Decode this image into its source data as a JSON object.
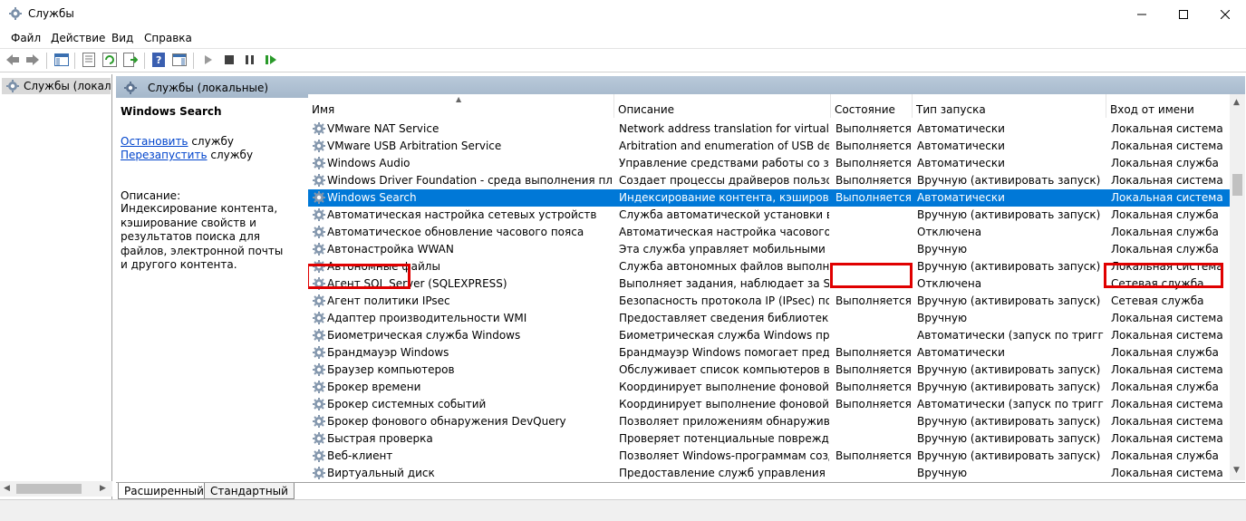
{
  "window": {
    "title": "Службы",
    "controls": {
      "minimize": "minimize-icon",
      "maximize": "maximize-icon",
      "close": "close-icon"
    }
  },
  "menu": {
    "file": "Файл",
    "action": "Действие",
    "view": "Вид",
    "help": "Справка"
  },
  "toolbar": {
    "icons": [
      "back-icon",
      "forward-icon",
      "show-console-tree-icon",
      "properties-icon",
      "refresh-icon",
      "export-list-icon",
      "help-icon",
      "show-hide-action-pane-icon",
      "start-service-icon",
      "stop-service-icon",
      "pause-service-icon",
      "restart-service-icon"
    ]
  },
  "tree": {
    "root_label": "Службы (локалы"
  },
  "pane": {
    "header": "Службы (локальные)"
  },
  "details": {
    "service_name": "Windows Search",
    "stop_link": "Остановить",
    "stop_suffix": " службу",
    "restart_link": "Перезапустить",
    "restart_suffix": " службу",
    "description_label": "Описание:",
    "description": "Индексирование контента, кэширование свойств и результатов поиска для файлов, электронной почты и другого контента."
  },
  "columns": {
    "name": "Имя",
    "description": "Описание",
    "status": "Состояние",
    "startup": "Тип запуска",
    "logon": "Вход от имени"
  },
  "services": [
    {
      "name": "VMware NAT Service",
      "description": "Network address translation for virtual ne...",
      "status": "Выполняется",
      "startup": "Автоматически",
      "logon": "Локальная система"
    },
    {
      "name": "VMware USB Arbitration Service",
      "description": "Arbitration and enumeration of USB device...",
      "status": "Выполняется",
      "startup": "Автоматически",
      "logon": "Локальная система"
    },
    {
      "name": "Windows Audio",
      "description": "Управление средствами работы со звуко...",
      "status": "Выполняется",
      "startup": "Автоматически",
      "logon": "Локальная служба"
    },
    {
      "name": "Windows Driver Foundation - среда выполнения платфо...",
      "description": "Создает процессы драйверов пользова...",
      "status": "Выполняется",
      "startup": "Вручную (активировать запуск)",
      "logon": "Локальная система"
    },
    {
      "name": "Windows Search",
      "description": "Индексирование контента, кэширован...",
      "status": "Выполняется",
      "startup": "Автоматически",
      "logon": "Локальная система",
      "selected": true
    },
    {
      "name": "Автоматическая настройка сетевых устройств",
      "description": "Служба автоматической установки вы...",
      "status": "",
      "startup": "Вручную (активировать запуск)",
      "logon": "Локальная служба"
    },
    {
      "name": "Автоматическое обновление часового пояса",
      "description": "Автоматическая настройка часового п...",
      "status": "",
      "startup": "Отключена",
      "logon": "Локальная служба"
    },
    {
      "name": "Автонастройка WWAN",
      "description": "Эта служба управляет мобильными ш...",
      "status": "",
      "startup": "Вручную",
      "logon": "Локальная служба"
    },
    {
      "name": "Автономные файлы",
      "description": "Служба автономных файлов выполняе...",
      "status": "",
      "startup": "Вручную (активировать запуск)",
      "logon": "Локальная система"
    },
    {
      "name": "Агент SQL Server (SQLEXPRESS)",
      "description": "Выполняет задания, наблюдает за SQL ...",
      "status": "",
      "startup": "Отключена",
      "logon": "Сетевая служба"
    },
    {
      "name": "Агент политики IPsec",
      "description": "Безопасность протокола IP (IPsec) подд...",
      "status": "Выполняется",
      "startup": "Вручную (активировать запуск)",
      "logon": "Сетевая служба"
    },
    {
      "name": "Адаптер производительности WMI",
      "description": "Предоставляет сведения библиотеки п...",
      "status": "",
      "startup": "Вручную",
      "logon": "Локальная система"
    },
    {
      "name": "Биометрическая служба Windows",
      "description": "Биометрическая служба Windows пред...",
      "status": "",
      "startup": "Автоматически (запуск по триггеру)",
      "logon": "Локальная система"
    },
    {
      "name": "Брандмауэр Windows",
      "description": "Брандмауэр Windows помогает предот...",
      "status": "Выполняется",
      "startup": "Автоматически",
      "logon": "Локальная служба"
    },
    {
      "name": "Браузер компьютеров",
      "description": "Обслуживает список компьютеров в с...",
      "status": "Выполняется",
      "startup": "Вручную (активировать запуск)",
      "logon": "Локальная система"
    },
    {
      "name": "Брокер времени",
      "description": "Координирует выполнение фоновой р...",
      "status": "Выполняется",
      "startup": "Вручную (активировать запуск)",
      "logon": "Локальная служба"
    },
    {
      "name": "Брокер системных событий",
      "description": "Координирует выполнение фоновой р...",
      "status": "Выполняется",
      "startup": "Автоматически (запуск по триггеру)",
      "logon": "Локальная система"
    },
    {
      "name": "Брокер фонового обнаружения DevQuery",
      "description": "Позволяет приложениям обнаруживат...",
      "status": "",
      "startup": "Вручную (активировать запуск)",
      "logon": "Локальная система"
    },
    {
      "name": "Быстрая проверка",
      "description": "Проверяет потенциальные поврежден...",
      "status": "",
      "startup": "Вручную (активировать запуск)",
      "logon": "Локальная система"
    },
    {
      "name": "Веб-клиент",
      "description": "Позволяет Windows-программам созд...",
      "status": "Выполняется",
      "startup": "Вручную (активировать запуск)",
      "logon": "Локальная служба"
    },
    {
      "name": "Виртуальный диск",
      "description": "Предоставление служб управления ди...",
      "status": "",
      "startup": "Вручную",
      "logon": "Локальная система"
    }
  ],
  "tabs": {
    "extended": "Расширенный",
    "standard": "Стандартный"
  },
  "colors": {
    "selection": "#0078d7",
    "highlight_box": "#e00000",
    "link": "#0044cc"
  }
}
